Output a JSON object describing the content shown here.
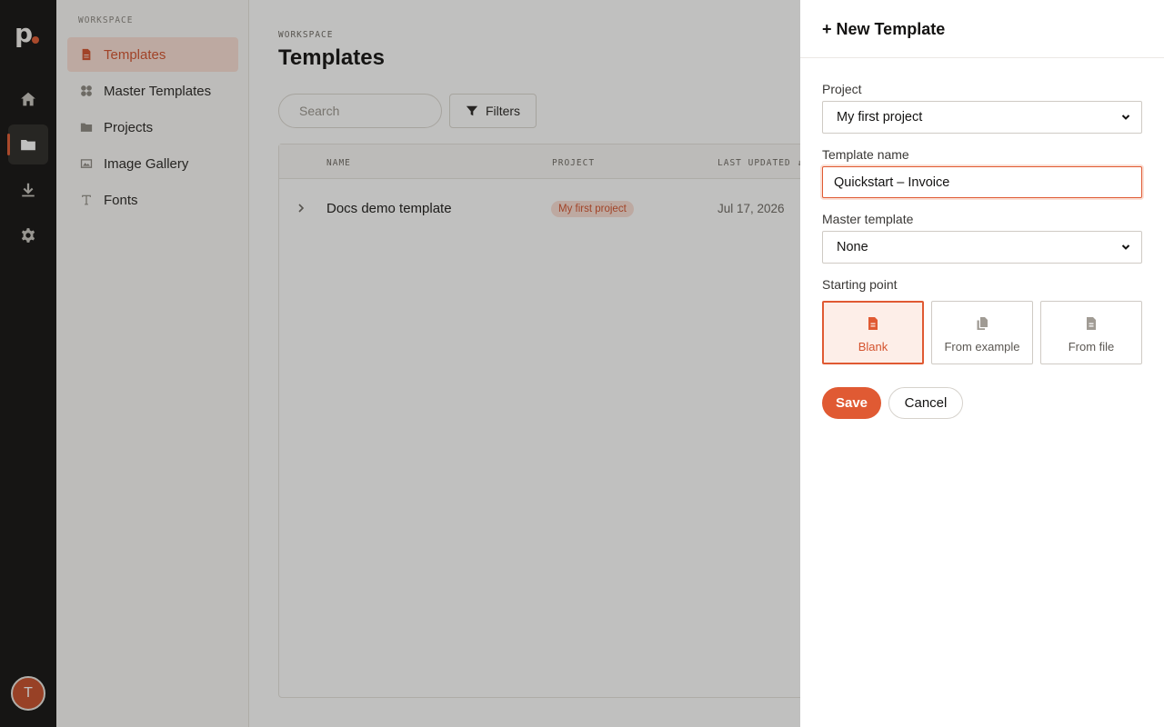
{
  "rail": {
    "logo_text": "p",
    "items": [
      {
        "name": "home-icon",
        "active": false
      },
      {
        "name": "folder-icon",
        "active": true
      },
      {
        "name": "download-icon",
        "active": false
      },
      {
        "name": "gear-icon",
        "active": false
      }
    ],
    "avatar_initial": "T"
  },
  "sidebar": {
    "section_label": "WORKSPACE",
    "items": [
      {
        "label": "Templates",
        "icon": "file-icon",
        "active": true
      },
      {
        "label": "Master Templates",
        "icon": "grid-icon",
        "active": false
      },
      {
        "label": "Projects",
        "icon": "folder-icon",
        "active": false
      },
      {
        "label": "Image Gallery",
        "icon": "image-icon",
        "active": false
      },
      {
        "label": "Fonts",
        "icon": "type-icon",
        "active": false
      }
    ]
  },
  "main": {
    "breadcrumb": "WORKSPACE",
    "title": "Templates",
    "search_placeholder": "Search",
    "filters_label": "Filters",
    "columns": [
      "NAME",
      "PROJECT",
      "LAST UPDATED ↓"
    ],
    "rows": [
      {
        "name": "Docs demo template",
        "project": "My first project",
        "updated": "Jul 17, 2026"
      }
    ]
  },
  "drawer": {
    "title": "+ New Template",
    "project_label": "Project",
    "project_value": "My first project",
    "template_name_label": "Template name",
    "template_name_value": "Quickstart – Invoice",
    "master_label": "Master template",
    "master_value": "None",
    "starting_label": "Starting point",
    "options": [
      {
        "label": "Blank",
        "icon": "file-icon",
        "selected": true
      },
      {
        "label": "From example",
        "icon": "copy-icon",
        "selected": false
      },
      {
        "label": "From file",
        "icon": "file-icon",
        "selected": false
      }
    ],
    "save_label": "Save",
    "cancel_label": "Cancel"
  },
  "colors": {
    "accent": "#e05a33",
    "accent_soft": "#fbe0d6",
    "rail_bg": "#141312"
  }
}
